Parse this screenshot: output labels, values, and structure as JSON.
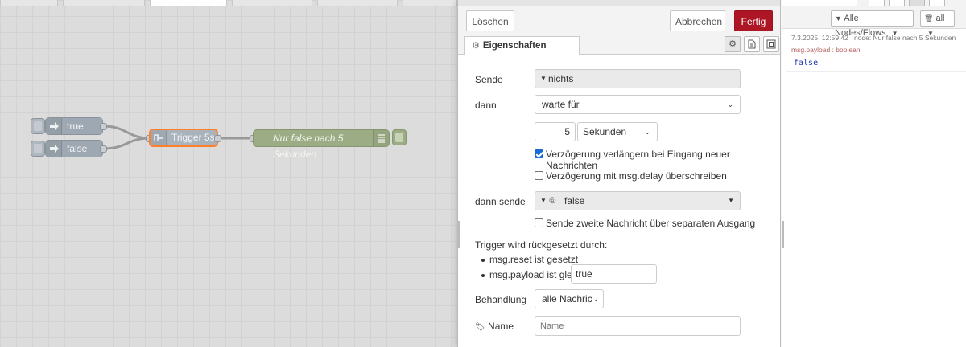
{
  "workspace": {
    "nodes": {
      "inject_true": {
        "label": "true"
      },
      "inject_false": {
        "label": "false"
      },
      "trigger": {
        "label": "Trigger 5s"
      },
      "debug": {
        "label": "Nur false nach 5 Sekunden"
      }
    }
  },
  "tray": {
    "buttons": {
      "delete": "Löschen",
      "cancel": "Abbrechen",
      "done": "Fertig"
    },
    "tabs": {
      "properties": "Eigenschaften"
    },
    "form": {
      "send_label": "Sende",
      "send_value": "nichts",
      "then_label": "dann",
      "then_value": "warte für",
      "duration_value": "5",
      "units_value": "Sekunden",
      "extend_label": "Verzögerung verlängern bei Eingang neuer Nachrichten",
      "extend_checked": true,
      "override_label": "Verzögerung mit msg.delay überschreiben",
      "override_checked": false,
      "then_send_label": "dann sende",
      "then_send_value": "false",
      "second_output_label": "Sende zweite Nachricht über separaten Ausgang",
      "second_output_checked": false,
      "reset_heading": "Trigger wird rückgesetzt durch:",
      "reset_item_1": "msg.reset ist gesetzt",
      "reset_item_2": "msg.payload ist gleich",
      "reset_payload_value": "true",
      "handling_label": "Behandlung",
      "handling_value": "alle Nachrichten",
      "name_label": "Name",
      "name_placeholder": "Name"
    }
  },
  "sidebar": {
    "filter_nodes": "Alle Nodes/Flows",
    "filter_all": "all",
    "message": {
      "timestamp": "7.3.2025, 12:59:42",
      "node": "node: Nur false nach 5 Sekunden",
      "path": "msg.payload : boolean",
      "value": "false"
    }
  },
  "colors": {
    "accent": "#ad1625",
    "selection": "#ff7f2a",
    "debug_node": "#9cad86",
    "inject_node": "#9ea8b2",
    "checkbox": "#1b6bd6"
  }
}
